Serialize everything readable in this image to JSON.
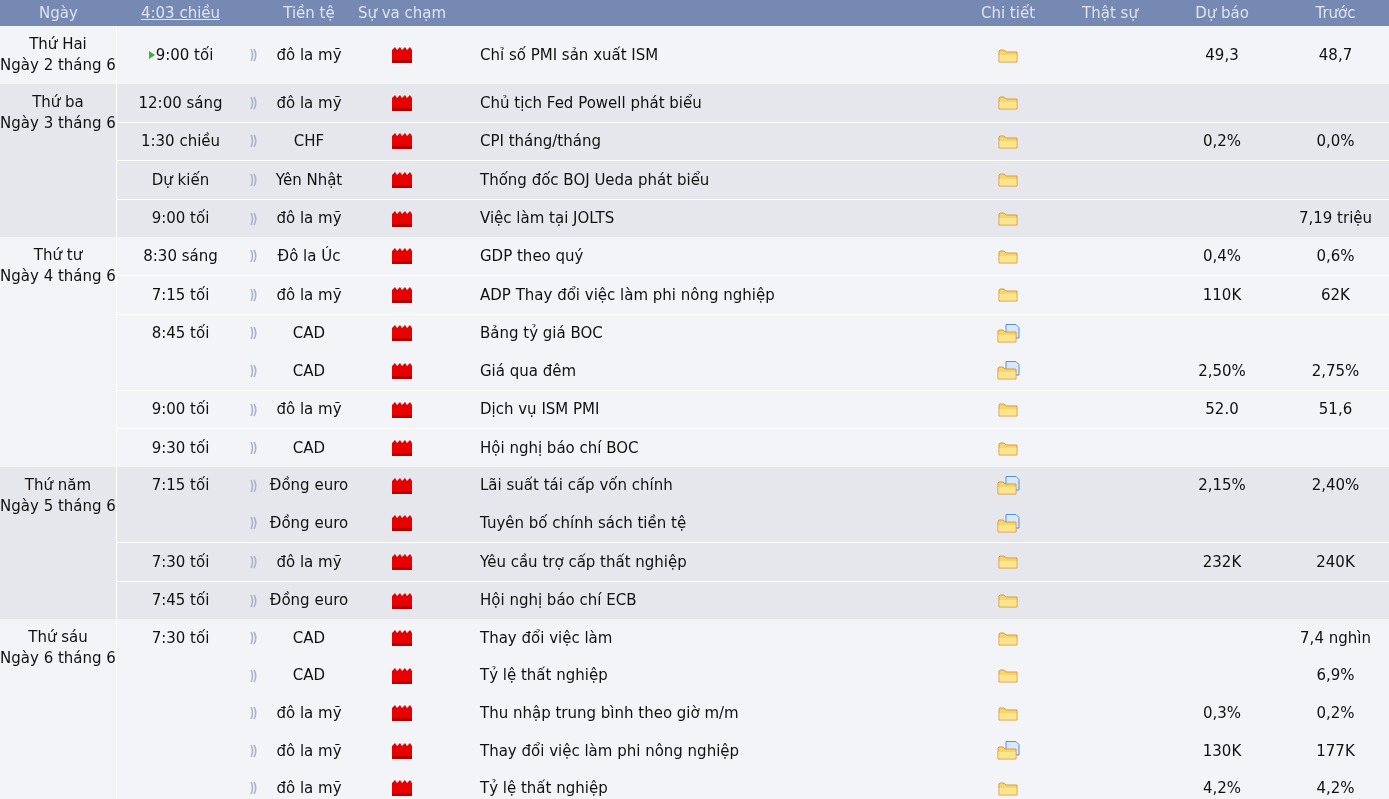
{
  "header": {
    "columns": [
      "Ngày",
      "4:03 chiều",
      "Tiền tệ",
      "Sự va chạm",
      "Chi tiết",
      "Thật sự",
      "Dự báo",
      "Trước"
    ]
  },
  "days": [
    {
      "weekday": "Thứ Hai",
      "date": "Ngày 2 tháng 6",
      "groups": [
        {
          "time": "9:00 tối",
          "next": true,
          "events": [
            {
              "currency": "đô la mỹ",
              "title": "Chỉ số PMI sản xuất ISM",
              "kind": "folder",
              "forecast": "49,3",
              "previous": "48,7"
            }
          ]
        }
      ]
    },
    {
      "weekday": "Thứ ba",
      "date": "Ngày 3 tháng 6",
      "groups": [
        {
          "time": "12:00 sáng",
          "next": false,
          "events": [
            {
              "currency": "đô la mỹ",
              "title": "Chủ tịch Fed Powell phát biểu",
              "kind": "folder"
            }
          ]
        },
        {
          "time": "1:30 chiều",
          "next": false,
          "events": [
            {
              "currency": "CHF",
              "title": "CPI tháng/tháng",
              "kind": "folder",
              "forecast": "0,2%",
              "previous": "0,0%"
            }
          ]
        },
        {
          "time": "Dự kiến",
          "next": false,
          "events": [
            {
              "currency": "Yên Nhật",
              "title": "Thống đốc BOJ Ueda phát biểu",
              "kind": "folder"
            }
          ]
        },
        {
          "time": "9:00 tối",
          "next": false,
          "events": [
            {
              "currency": "đô la mỹ",
              "title": "Việc làm tại JOLTS",
              "kind": "folder",
              "previous": "7,19 triệu"
            }
          ]
        }
      ]
    },
    {
      "weekday": "Thứ tư",
      "date": "Ngày 4 tháng 6",
      "groups": [
        {
          "time": "8:30 sáng",
          "next": false,
          "events": [
            {
              "currency": "Đô la Úc",
              "title": "GDP theo quý",
              "kind": "folder",
              "forecast": "0,4%",
              "previous": "0,6%"
            }
          ]
        },
        {
          "time": "7:15 tối",
          "next": false,
          "events": [
            {
              "currency": "đô la mỹ",
              "title": "ADP Thay đổi việc làm phi nông nghiệp",
              "kind": "folder",
              "forecast": "110K",
              "previous": "62K"
            }
          ]
        },
        {
          "time": "8:45 tối",
          "next": false,
          "events": [
            {
              "currency": "CAD",
              "title": "Bảng tỷ giá BOC",
              "kind": "folder_doc"
            },
            {
              "currency": "CAD",
              "title": "Giá qua đêm",
              "kind": "folder_doc",
              "forecast": "2,50%",
              "previous": "2,75%"
            }
          ]
        },
        {
          "time": "9:00 tối",
          "next": false,
          "events": [
            {
              "currency": "đô la mỹ",
              "title": "Dịch vụ ISM PMI",
              "kind": "folder",
              "forecast": "52.0",
              "previous": "51,6"
            }
          ]
        },
        {
          "time": "9:30 tối",
          "next": false,
          "events": [
            {
              "currency": "CAD",
              "title": "Hội nghị báo chí BOC",
              "kind": "folder"
            }
          ]
        }
      ]
    },
    {
      "weekday": "Thứ năm",
      "date": "Ngày 5 tháng 6",
      "groups": [
        {
          "time": "7:15 tối",
          "next": false,
          "events": [
            {
              "currency": "Đồng euro",
              "title": "Lãi suất tái cấp vốn chính",
              "kind": "folder_doc",
              "forecast": "2,15%",
              "previous": "2,40%"
            },
            {
              "currency": "Đồng euro",
              "title": "Tuyên bố chính sách tiền tệ",
              "kind": "folder_doc"
            }
          ]
        },
        {
          "time": "7:30 tối",
          "next": false,
          "events": [
            {
              "currency": "đô la mỹ",
              "title": "Yêu cầu trợ cấp thất nghiệp",
              "kind": "folder",
              "forecast": "232K",
              "previous": "240K"
            }
          ]
        },
        {
          "time": "7:45 tối",
          "next": false,
          "events": [
            {
              "currency": "Đồng euro",
              "title": "Hội nghị báo chí ECB",
              "kind": "folder"
            }
          ]
        }
      ]
    },
    {
      "weekday": "Thứ sáu",
      "date": "Ngày 6 tháng 6",
      "groups": [
        {
          "time": "7:30 tối",
          "next": false,
          "events": [
            {
              "currency": "CAD",
              "title": "Thay đổi việc làm",
              "kind": "folder",
              "previous": "7,4 nghìn"
            },
            {
              "currency": "CAD",
              "title": "Tỷ lệ thất nghiệp",
              "kind": "folder",
              "previous": "6,9%"
            },
            {
              "currency": "đô la mỹ",
              "title": "Thu nhập trung bình theo giờ m/m",
              "kind": "folder",
              "forecast": "0,3%",
              "previous": "0,2%"
            },
            {
              "currency": "đô la mỹ",
              "title": "Thay đổi việc làm phi nông nghiệp",
              "kind": "folder_doc",
              "forecast": "130K",
              "previous": "177K"
            },
            {
              "currency": "đô la mỹ",
              "title": "Tỷ lệ thất nghiệp",
              "kind": "folder",
              "forecast": "4,2%",
              "previous": "4,2%"
            }
          ]
        }
      ]
    }
  ]
}
